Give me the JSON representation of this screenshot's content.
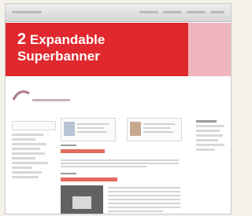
{
  "banner": {
    "number": "2",
    "line1": "Expandable",
    "line2": "Superbanner",
    "color": "#e0282e",
    "secondary_color": "#f0b6bd"
  }
}
